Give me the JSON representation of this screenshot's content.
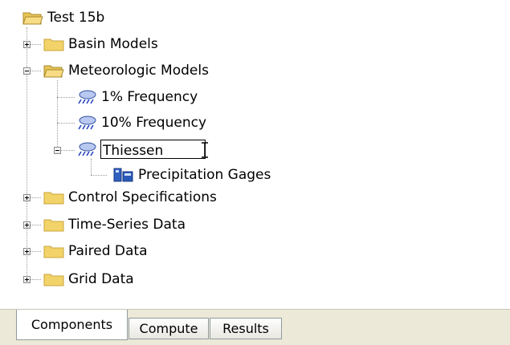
{
  "tree": {
    "root": {
      "label": "Test 15b"
    },
    "basin_models": {
      "label": "Basin Models"
    },
    "meteorologic_models": {
      "label": "Meteorologic Models"
    },
    "met_1pct": {
      "label": "1% Frequency"
    },
    "met_10pct": {
      "label": "10% Frequency"
    },
    "thiessen": {
      "label": "Thiessen"
    },
    "precip_gages": {
      "label": "Precipitation Gages"
    },
    "control_specs": {
      "label": "Control Specifications"
    },
    "time_series": {
      "label": "Time-Series Data"
    },
    "paired_data": {
      "label": "Paired Data"
    },
    "grid_data": {
      "label": "Grid Data"
    }
  },
  "tabs": [
    {
      "label": "Components",
      "active": true
    },
    {
      "label": "Compute",
      "active": false
    },
    {
      "label": "Results",
      "active": false
    }
  ],
  "colors": {
    "folder": "#f2d36a",
    "folder_dark": "#c9a43a",
    "tab_bg": "#ece9d8",
    "tab_border": "#919b9c"
  },
  "icons": {
    "folder": "folder-icon",
    "open_folder": "open-folder-icon",
    "met_model": "rain-cloud-icon",
    "gages": "precipitation-gages-icon",
    "cursor": "i-beam-cursor-icon"
  }
}
